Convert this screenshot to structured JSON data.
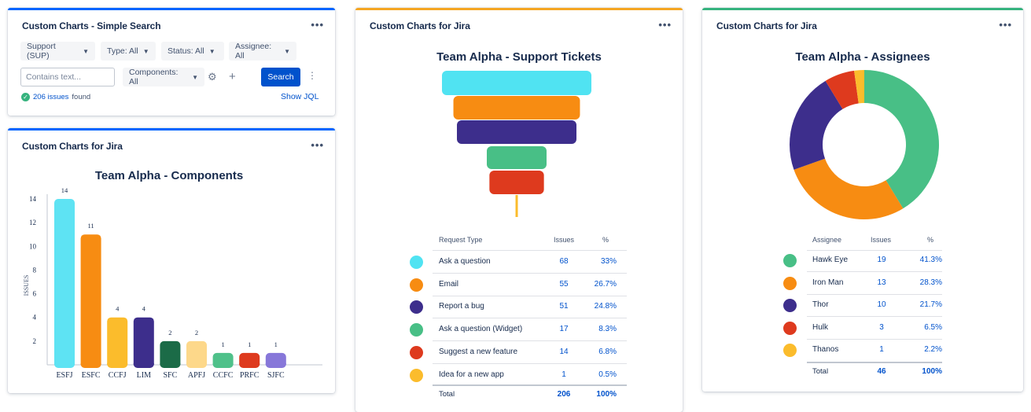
{
  "search_gadget": {
    "title": "Custom Charts - Simple Search",
    "menu": "•••",
    "filters": [
      "Support (SUP)",
      "Type: All",
      "Status: All",
      "Assignee: All"
    ],
    "text_placeholder": "Contains text...",
    "components_filter": "Components: All",
    "search_button": "Search",
    "issues_count": "206 issues",
    "found_label": "found",
    "show_jql": "Show JQL",
    "colors": {
      "accent": "#0065ff"
    }
  },
  "components_gadget": {
    "title": "Custom Charts for Jira",
    "menu": "•••",
    "chart_data": {
      "type": "bar",
      "title": "Team Alpha - Components",
      "ylabel": "ISSUES",
      "xlabel": "",
      "categories": [
        "ESFJ",
        "ESFC",
        "CCFJ",
        "LIM",
        "SFC",
        "APFJ",
        "CCFC",
        "PRFC",
        "SJFC"
      ],
      "values": [
        14,
        11,
        4,
        4,
        2,
        2,
        1,
        1,
        1
      ],
      "colors": [
        "#5ee3f3",
        "#f78c12",
        "#fbbc2c",
        "#3d2e8c",
        "#1b6b47",
        "#fdd88a",
        "#4fc18a",
        "#de3a1e",
        "#8777d9"
      ],
      "yticks": [
        2,
        4,
        6,
        8,
        10,
        12,
        14
      ],
      "ylim": [
        0,
        15
      ],
      "grid": false
    }
  },
  "tickets_gadget": {
    "title": "Custom Charts for Jira",
    "menu": "•••",
    "chart_data": {
      "type": "funnel",
      "title": "Team Alpha - Support Tickets",
      "columns": [
        "Request Type",
        "Issues",
        "%"
      ],
      "rows": [
        {
          "label": "Ask a question",
          "issues": 68,
          "pct": "33%",
          "color": "#50e3f2"
        },
        {
          "label": "Email",
          "issues": 55,
          "pct": "26.7%",
          "color": "#f78c12"
        },
        {
          "label": "Report a bug",
          "issues": 51,
          "pct": "24.8%",
          "color": "#3d2e8c"
        },
        {
          "label": "Ask a question (Widget)",
          "issues": 17,
          "pct": "8.3%",
          "color": "#48bf86"
        },
        {
          "label": "Suggest a new feature",
          "issues": 14,
          "pct": "6.8%",
          "color": "#de3a1e"
        },
        {
          "label": "Idea for a new app",
          "issues": 1,
          "pct": "0.5%",
          "color": "#fbbc2c"
        }
      ],
      "total": {
        "label": "Total",
        "issues": 206,
        "pct": "100%"
      }
    }
  },
  "assignees_gadget": {
    "title": "Custom Charts for Jira",
    "menu": "•••",
    "chart_data": {
      "type": "donut",
      "title": "Team Alpha - Assignees",
      "columns": [
        "Assignee",
        "Issues",
        "%"
      ],
      "rows": [
        {
          "label": "Hawk Eye",
          "issues": 19,
          "pct": "41.3%",
          "color": "#48bf86"
        },
        {
          "label": "Iron Man",
          "issues": 13,
          "pct": "28.3%",
          "color": "#f78c12"
        },
        {
          "label": "Thor",
          "issues": 10,
          "pct": "21.7%",
          "color": "#3d2e8c"
        },
        {
          "label": "Hulk",
          "issues": 3,
          "pct": "6.5%",
          "color": "#de3a1e"
        },
        {
          "label": "Thanos",
          "issues": 1,
          "pct": "2.2%",
          "color": "#fbbc2c"
        }
      ],
      "total": {
        "label": "Total",
        "issues": 46,
        "pct": "100%"
      }
    }
  },
  "colors": {
    "blue": "#0065ff",
    "yellow": "#f5a623",
    "green": "#36b37e"
  }
}
